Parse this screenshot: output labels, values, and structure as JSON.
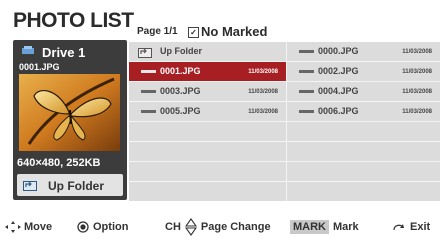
{
  "title": "PHOTO LIST",
  "page_info": "Page 1/1",
  "marked_status": "No Marked",
  "preview": {
    "drive_label": "Drive 1",
    "file_name": "0001.JPG",
    "resolution_size": "640×480, 252KB",
    "up_folder_label": "Up Folder"
  },
  "files": {
    "left": [
      {
        "name": "Up Folder",
        "date": ""
      },
      {
        "name": "0001.JPG",
        "date": "11/03/2008"
      },
      {
        "name": "0003.JPG",
        "date": "11/03/2008"
      },
      {
        "name": "0005.JPG",
        "date": "11/03/2008"
      }
    ],
    "right": [
      {
        "name": "0000.JPG",
        "date": "11/03/2008"
      },
      {
        "name": "0002.JPG",
        "date": "11/03/2008"
      },
      {
        "name": "0004.JPG",
        "date": "11/03/2008"
      },
      {
        "name": "0006.JPG",
        "date": "11/03/2008"
      }
    ]
  },
  "footer": {
    "move": "Move",
    "option": "Option",
    "ch": "CH",
    "page_change": "Page Change",
    "mark_badge": "MARK",
    "mark": "Mark",
    "exit": "Exit"
  },
  "colors": {
    "selection": "#a81f23",
    "list_bg": "#dcdcdc",
    "preview_bg": "#3c3c3c"
  }
}
